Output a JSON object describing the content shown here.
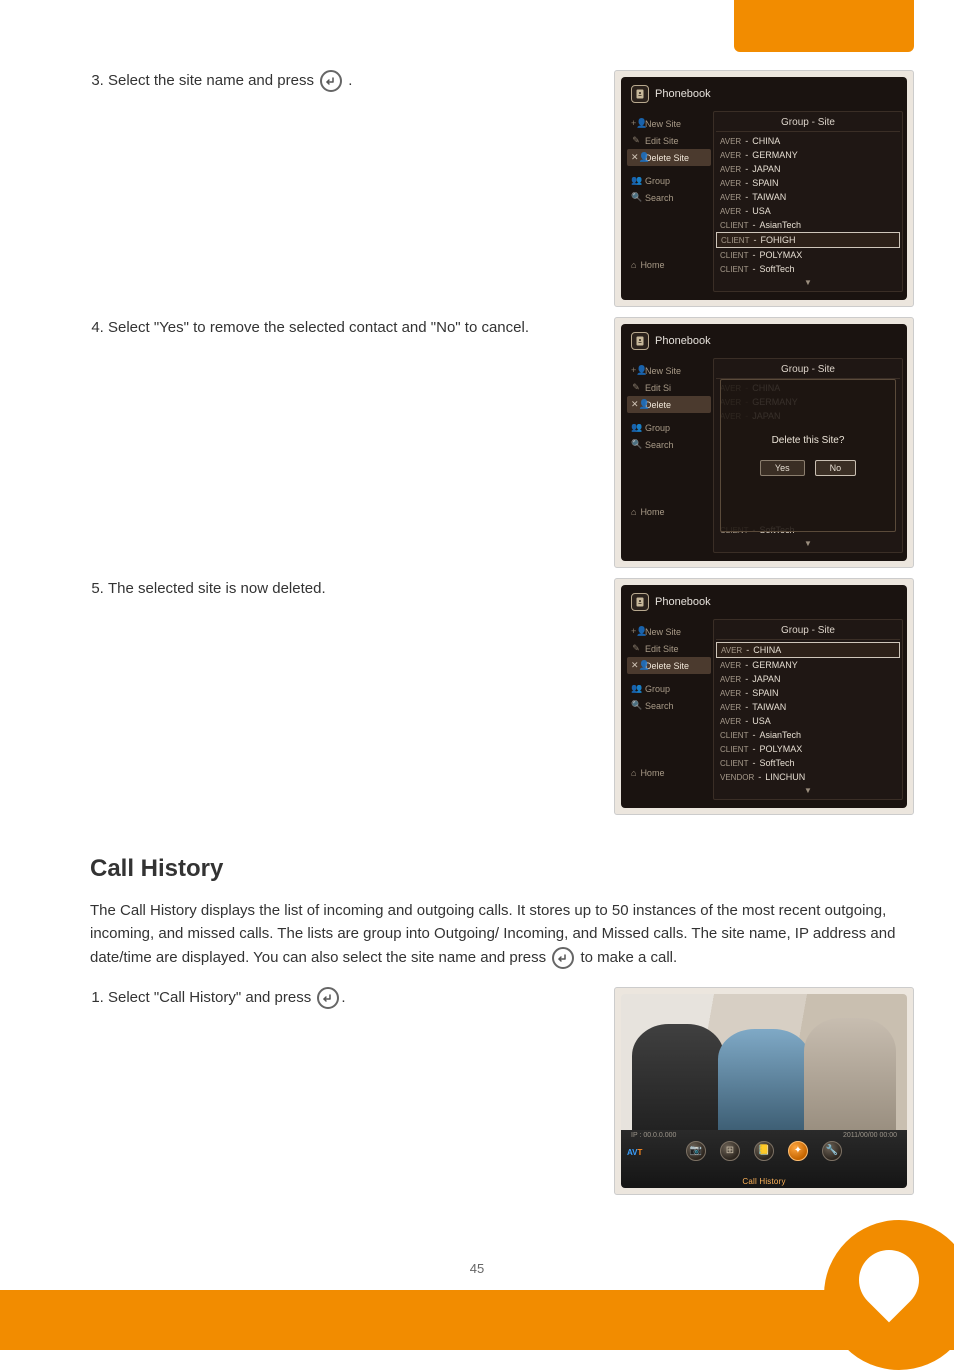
{
  "step3": {
    "prefix": "Select the site name and press",
    "suffix": "."
  },
  "step4": {
    "text": "Select \"Yes\" to remove the selected contact and \"No\" to cancel."
  },
  "step5": {
    "text": "The selected site is now deleted."
  },
  "phonebook": {
    "header": "Phonebook",
    "title": "Group - Site",
    "sidebar": {
      "new_site": "New Site",
      "edit_site": "Edit Site",
      "delete_site": "Delete Site",
      "group": "Group",
      "search": "Search",
      "home": "Home"
    }
  },
  "pb1": {
    "rows": [
      {
        "tag": "AVER",
        "name": "CHINA",
        "sel": false
      },
      {
        "tag": "AVER",
        "name": "GERMANY",
        "sel": false
      },
      {
        "tag": "AVER",
        "name": "JAPAN",
        "sel": false
      },
      {
        "tag": "AVER",
        "name": "SPAIN",
        "sel": false
      },
      {
        "tag": "AVER",
        "name": "TAIWAN",
        "sel": false
      },
      {
        "tag": "AVER",
        "name": "USA",
        "sel": false
      },
      {
        "tag": "CLIENT",
        "name": "AsianTech",
        "sel": false
      },
      {
        "tag": "CLIENT",
        "name": "FOHIGH",
        "sel": true
      },
      {
        "tag": "CLIENT",
        "name": "POLYMAX",
        "sel": false
      },
      {
        "tag": "CLIENT",
        "name": "SoftTech",
        "sel": false
      }
    ]
  },
  "pb2": {
    "sidebar_edit_short": "Edit Si",
    "sidebar_delete_short": "Delete",
    "dim_rows": [
      {
        "tag": "AVER",
        "name": "CHINA"
      },
      {
        "tag": "AVER",
        "name": "GERMANY"
      },
      {
        "tag": "AVER",
        "name": "JAPAN"
      }
    ],
    "dialog": {
      "question": "Delete this Site?",
      "yes": "Yes",
      "no": "No"
    },
    "below_row": {
      "tag": "CLIENT",
      "name": "SoftTech"
    }
  },
  "pb3": {
    "rows": [
      {
        "tag": "AVER",
        "name": "CHINA",
        "sel": true
      },
      {
        "tag": "AVER",
        "name": "GERMANY",
        "sel": false
      },
      {
        "tag": "AVER",
        "name": "JAPAN",
        "sel": false
      },
      {
        "tag": "AVER",
        "name": "SPAIN",
        "sel": false
      },
      {
        "tag": "AVER",
        "name": "TAIWAN",
        "sel": false
      },
      {
        "tag": "AVER",
        "name": "USA",
        "sel": false
      },
      {
        "tag": "CLIENT",
        "name": "AsianTech",
        "sel": false
      },
      {
        "tag": "CLIENT",
        "name": "POLYMAX",
        "sel": false
      },
      {
        "tag": "CLIENT",
        "name": "SoftTech",
        "sel": false
      },
      {
        "tag": "VENDOR",
        "name": "LINCHUN",
        "sel": false
      }
    ]
  },
  "callhistory": {
    "heading": "Call History",
    "desc_prefix": "The Call History displays the list of incoming and outgoing calls. It stores up to 50 instances of the most recent outgoing, incoming, and missed calls. The lists are group into Outgoing/ Incoming, and Missed calls. The site name, IP address and date/time are displayed. You can also select the site name and press",
    "desc_suffix": "to make a call.",
    "step1_text": "Select \"Call History\" and press",
    "status_ip": "IP : 00.0.0.000",
    "status_datetime": "2011/00/00 00:00",
    "brand_av": "AV",
    "brand_t": "T",
    "label": "Call History"
  },
  "page_number": "45"
}
